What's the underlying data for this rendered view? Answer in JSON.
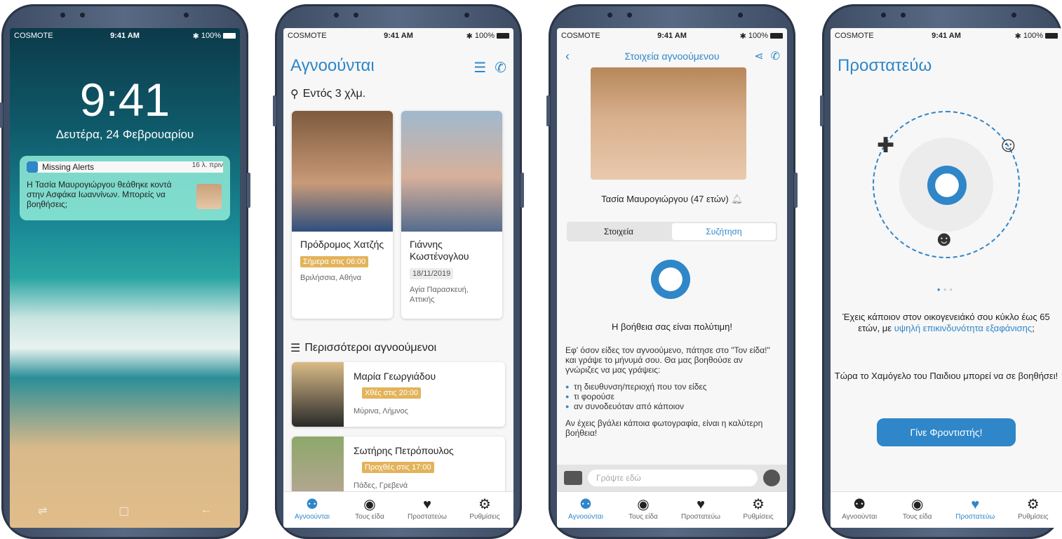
{
  "status": {
    "carrier": "COSMOTE",
    "time": "9:41 AM",
    "battery": "100%"
  },
  "lockscreen": {
    "time": "9:41",
    "date": "Δευτέρα, 24 Φεβρουαρίου",
    "notification": {
      "app": "Missing Alerts",
      "ago": "16 λ. πριν",
      "body": "Η Τασία Μαυρογιώργου θεάθηκε κοντά στην Ασφάκα Ιωαννίνων. Μπορείς να βοηθήσεις;"
    }
  },
  "list_screen": {
    "title": "Αγνοούνται",
    "nearby_heading": "Εντός 3 χλμ.",
    "nearby": [
      {
        "name": "Πρόδρομος Χατζής",
        "date": "Σήμερα στις 06:00",
        "location": "Βριλήσσια, Αθήνα"
      },
      {
        "name": "Γιάννης Κωστένογλου",
        "date": "18/11/2019",
        "location": "Αγία Παρασκευή, Αττικής"
      }
    ],
    "more_heading": "Περισσότεροι αγνοούμενοι",
    "more": [
      {
        "name": "Μαρία Γεωργιάδου",
        "date": "Χθές στις 20:00",
        "location": "Μύρινα, Λήμνος"
      },
      {
        "name": "Σωτήρης Πετρόπουλος",
        "date": "Προχθές στις 17:00",
        "location": "Πάδες, Γρεβενά"
      }
    ]
  },
  "detail_screen": {
    "title": "Στοιχεία αγνοούμενου",
    "name": "Τασία Μαυρογιώργου (47 ετών)",
    "tabs": [
      "Στοιχεία",
      "Συζήτηση"
    ],
    "help_title": "Η βοήθεια σας είναι πολύτιμη!",
    "help_intro": "Εφ' όσον είδες τον αγνοούμενο, πάτησε στο \"Τον είδα!\" και γράψε το μήνυμά σου. Θα μας βοηθούσε αν γνώριζες να μας γράψεις:",
    "help_points": [
      "τη διευθυνση/περιοχή που τον είδες",
      "τι φορούσε",
      "αν συνοδευόταν από κάποιον"
    ],
    "help_outro": "Αν έχεις βγάλει κάποια φωτογραφία, είναι η καλύτερη βοήθεια!",
    "input_placeholder": "Γράψτε εδώ"
  },
  "protect_screen": {
    "title": "Προστατεύω",
    "text1a": "Έχεις κάποιον στον οικογενειάκό σου κύκλο έως 65 ετών, με ",
    "text1b": "υψηλή επικινδυνότητα εξαφάνισης",
    "text1c": ";",
    "text2": "Τώρα το Χαμόγελο του Παιδιου μπορεί να σε βοηθήσει!",
    "cta": "Γίνε Φροντιστής!"
  },
  "tabs": [
    "Αγνοούνται",
    "Τους είδα",
    "Προστατεύω",
    "Ρυθμίσεις"
  ],
  "colors": {
    "accent": "#2f86c8",
    "badge": "#e3b35a"
  }
}
